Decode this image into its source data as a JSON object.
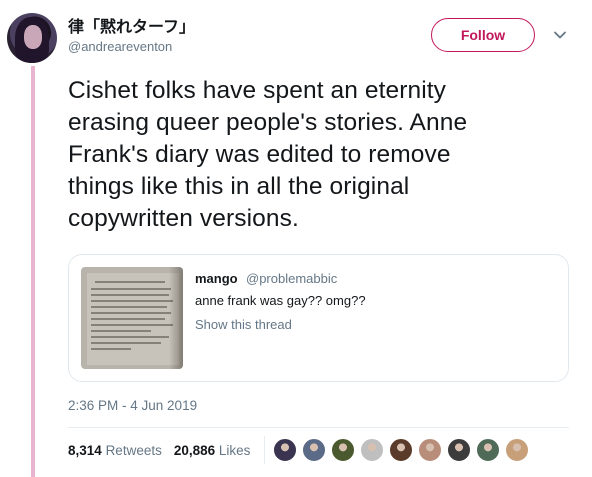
{
  "author": {
    "display_name": "律「黙れターフ」",
    "handle": "@andreareventon"
  },
  "actions": {
    "follow_label": "Follow"
  },
  "tweet": {
    "lines": [
      "Cishet folks have spent an eternity",
      "erasing queer people's stories. Anne",
      "Frank's diary was edited to remove",
      "things like this in all the original",
      "copywritten versions."
    ],
    "timestamp": "2:36 PM - 4 Jun 2019"
  },
  "quote": {
    "name": "mango",
    "handle": "@problemabbic",
    "text": "anne frank was gay?? omg??",
    "link": "Show this thread"
  },
  "stats": {
    "retweets_count": "8,314",
    "retweets_label": "Retweets",
    "likes_count": "20,886",
    "likes_label": "Likes"
  },
  "likers": [
    {
      "name": "liker-1",
      "color": "#3a3450"
    },
    {
      "name": "liker-2",
      "color": "#5b6a86"
    },
    {
      "name": "liker-3",
      "color": "#4b5a2e"
    },
    {
      "name": "liker-4",
      "color": "#bfbfbf"
    },
    {
      "name": "liker-5",
      "color": "#5a3a28"
    },
    {
      "name": "liker-6",
      "color": "#b88e7a"
    },
    {
      "name": "liker-7",
      "color": "#3c3c3c"
    },
    {
      "name": "liker-8",
      "color": "#4f6b58"
    },
    {
      "name": "liker-9",
      "color": "#c7a07a"
    }
  ],
  "colors": {
    "accent": "#c2185b",
    "thread_line": "#e8b4d0",
    "muted_text": "#657786"
  }
}
